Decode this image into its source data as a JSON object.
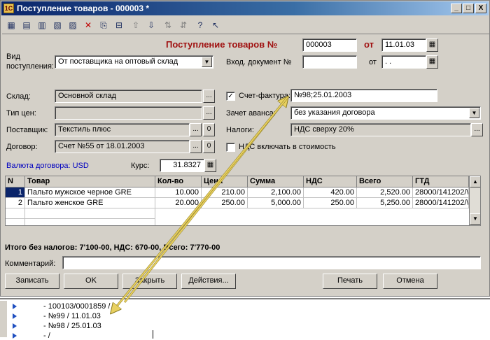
{
  "window": {
    "title": "Поступление товаров - 000003 *",
    "btn_min": "_",
    "btn_max": "□",
    "btn_close": "X"
  },
  "header": {
    "doc_title": "Поступление товаров №",
    "doc_number": "000003",
    "from_label": "от",
    "doc_date": "11.01.03"
  },
  "form": {
    "vid_label_1": "Вид",
    "vid_label_2": "поступления:",
    "vid_value": "От поставщика на оптовый склад",
    "incoming_doc_label": "Вход. документ №",
    "incoming_doc_value": "",
    "from2_label": "от",
    "incoming_date_value": " .  .",
    "sklad_label": "Склад:",
    "sklad_value": "Основной склад",
    "invoice_label": "Счет-фактура:",
    "invoice_value": "№98;25.01.2003",
    "tip_cen_label": "Тип цен:",
    "tip_cen_value": "",
    "advance_label": "Зачет аванса:",
    "advance_value": "без указания договора",
    "supplier_label": "Поставщик:",
    "supplier_value": "Текстиль плюс",
    "taxes_label": "Налоги:",
    "taxes_value": "НДС сверху 20%",
    "contract_label": "Договор:",
    "contract_value": "Счет №55 от 18.01.2003",
    "vat_include_label": "НДС включать в стоимость",
    "currency_label": "Валюта договора: USD",
    "rate_label": "Курс:",
    "rate_value": "31.8327",
    "btn_dots": "...",
    "btn_clear": "0"
  },
  "table": {
    "headers": [
      "N",
      "Товар",
      "Кол-во",
      "Цена",
      "Сумма",
      "НДС",
      "Всего",
      "ГТД"
    ],
    "rows": [
      [
        "1",
        "Пальто мужское черное GRE",
        "10.000",
        "210.00",
        "2,100.00",
        "420.00",
        "2,520.00",
        "28000/141202/\\"
      ],
      [
        "2",
        "Пальто женское  GRE",
        "20.000",
        "250.00",
        "5,000.00",
        "250.00",
        "5,250.00",
        "28000/141202/\\"
      ]
    ]
  },
  "totals": "Итого без налогов: 7'100-00, НДС: 670-00, Всего: 7'770-00",
  "comment_label": "Комментарий:",
  "comment_value": "",
  "buttons": {
    "record": "Записать",
    "ok": "OK",
    "close": "Закрыть",
    "actions": "Действия...",
    "print": "Печать",
    "cancel": "Отмена"
  },
  "tree": {
    "items": [
      "- 100103/0001859 /",
      "- №99 / 11.01.03",
      "- №98 / 25.01.03",
      "- /"
    ]
  },
  "colors": {
    "title_red": "#a01010",
    "link_blue": "#0000c0",
    "annotation": "#e8d060"
  }
}
